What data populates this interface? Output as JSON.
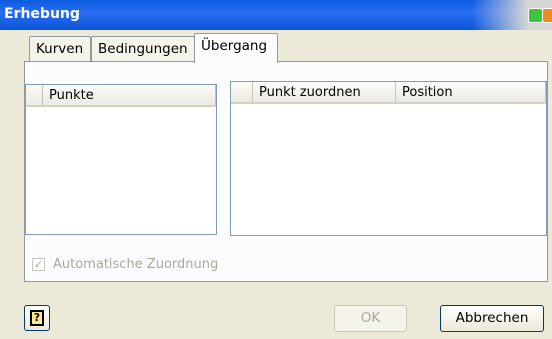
{
  "window": {
    "title": "Erhebung"
  },
  "tabs": [
    {
      "label": "Kurven"
    },
    {
      "label": "Bedingungen"
    },
    {
      "label": "Übergang"
    }
  ],
  "lists": {
    "left": {
      "column": "Punkte"
    },
    "right": {
      "columns": [
        "Punkt zuordnen",
        "Position"
      ]
    }
  },
  "auto_assign": {
    "label": "Automatische Zuordnung",
    "checked": true,
    "enabled": false
  },
  "buttons": {
    "help": "?",
    "ok": "OK",
    "cancel": "Abbrechen"
  },
  "colors": {
    "titlebar": "#0a5be0",
    "dialog_bg": "#ece9d8",
    "panel_bg": "#fcfcfe"
  }
}
